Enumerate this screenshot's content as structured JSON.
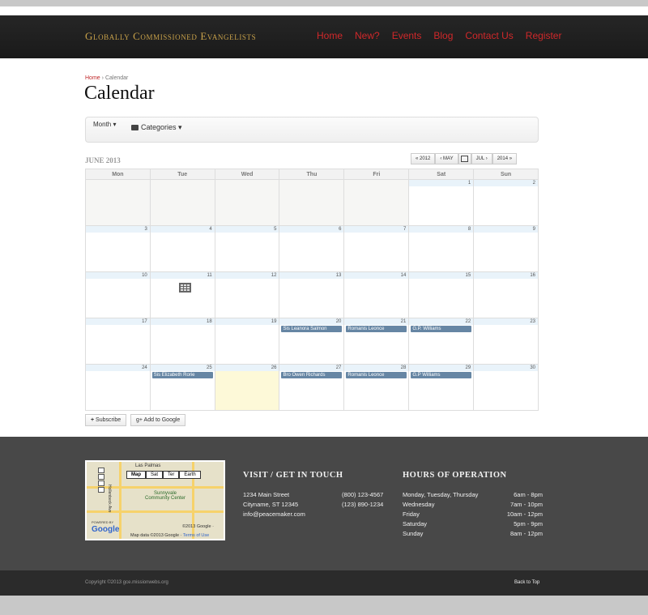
{
  "brand": "Globally Commissioned Evangelists",
  "nav": [
    "Home",
    "New?",
    "Events",
    "Blog",
    "Contact Us",
    "Register"
  ],
  "breadcrumb": {
    "home": "Home",
    "sep": "›",
    "current": "Calendar"
  },
  "page_title": "Calendar",
  "toolbar": {
    "view_label": "Month",
    "categories_label": "Categories"
  },
  "calendar": {
    "month_label": "JUNE 2013",
    "pager": {
      "prev_year": "« 2012",
      "prev_month": "‹ MAY",
      "next_month": "JUL ›",
      "next_year": "2014 »"
    },
    "weekdays": [
      "Mon",
      "Tue",
      "Wed",
      "Thu",
      "Fri",
      "Sat",
      "Sun"
    ],
    "weeks": [
      [
        null,
        null,
        null,
        null,
        null,
        {
          "day": "1"
        },
        {
          "day": "2"
        }
      ],
      [
        {
          "day": "3"
        },
        {
          "day": "4"
        },
        {
          "day": "5"
        },
        {
          "day": "6"
        },
        {
          "day": "7"
        },
        {
          "day": "8"
        },
        {
          "day": "9"
        }
      ],
      [
        {
          "day": "10"
        },
        {
          "day": "11"
        },
        {
          "day": "12"
        },
        {
          "day": "13"
        },
        {
          "day": "14"
        },
        {
          "day": "15"
        },
        {
          "day": "16"
        }
      ],
      [
        {
          "day": "17"
        },
        {
          "day": "18"
        },
        {
          "day": "19"
        },
        {
          "day": "20",
          "event": "Sis Leanora Salmon"
        },
        {
          "day": "21",
          "event": "Romanis Leonce"
        },
        {
          "day": "22",
          "event": "G.P. Williams"
        },
        {
          "day": "23"
        }
      ],
      [
        {
          "day": "24"
        },
        {
          "day": "25",
          "event": "Sis Elizabeth Rorie"
        },
        {
          "day": "26",
          "today": true
        },
        {
          "day": "27",
          "event": "Bro Owen Richards"
        },
        {
          "day": "28",
          "event": "Romanis Leonce"
        },
        {
          "day": "29",
          "event": "G.P Williams"
        },
        {
          "day": "30"
        }
      ]
    ]
  },
  "actions": {
    "subscribe": "Subscribe",
    "add_google": "Add to Google"
  },
  "map": {
    "tabs": [
      "Map",
      "Sat",
      "Ter",
      "Earth"
    ],
    "place_top": "Las Palmas",
    "place_main": "Sunnyvale Community Center",
    "street": "Hollenbeck Ave",
    "copyright": "©2013 Google ·",
    "footer_text": "Map data ©2013 Google ·",
    "terms": "Terms of Use",
    "logo": "Google",
    "powered": "POWERED BY"
  },
  "contact": {
    "heading": "VISIT / GET IN TOUCH",
    "lines": [
      {
        "left": "1234 Main Street",
        "right": "(800) 123-4567"
      },
      {
        "left": "Cityname, ST 12345",
        "right": "(123) 890-1234"
      },
      {
        "left": "info@peacemaker.com",
        "right": ""
      }
    ]
  },
  "hours": {
    "heading": "HOURS OF OPERATION",
    "rows": [
      {
        "day": "Monday, Tuesday, Thursday",
        "time": "6am - 8pm"
      },
      {
        "day": "Wednesday",
        "time": "7am - 10pm"
      },
      {
        "day": "Friday",
        "time": "10am - 12pm"
      },
      {
        "day": "Saturday",
        "time": "5pm - 9pm"
      },
      {
        "day": "Sunday",
        "time": "8am - 12pm"
      }
    ]
  },
  "copyright": "Copyright ©2013 gce.missionwebs.org",
  "back_to_top": "Back to Top"
}
